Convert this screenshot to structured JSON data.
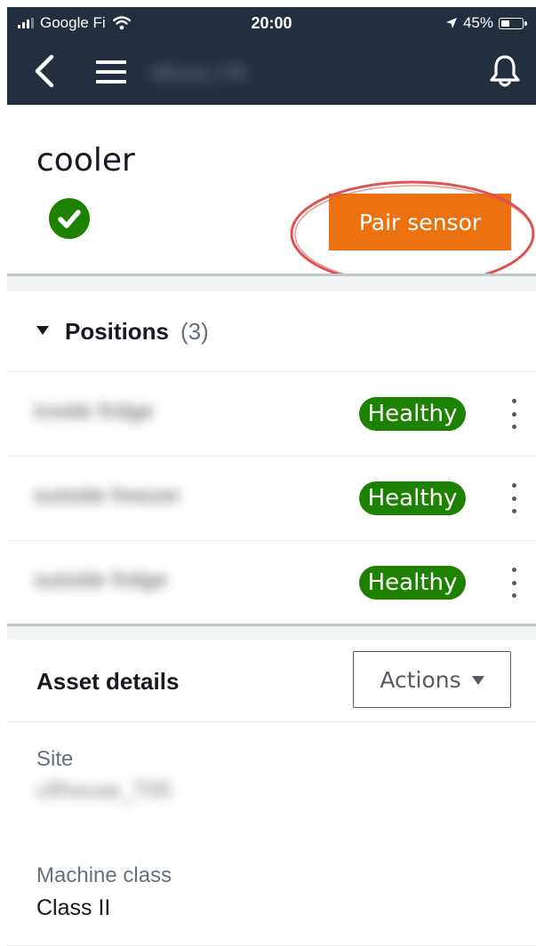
{
  "status_bar": {
    "carrier": "Google Fi",
    "time": "20:00",
    "battery": "45%",
    "battery_level": 0.45
  },
  "navbar": {
    "site_name": "ctfhouse_T05"
  },
  "asset": {
    "name": "cooler",
    "status": "ok",
    "pair_button_label": "Pair sensor"
  },
  "positions": {
    "title": "Positions",
    "count": "(3)",
    "items": [
      {
        "name": "inside fridge",
        "badge": "Healthy"
      },
      {
        "name": "outside freezer",
        "badge": "Healthy"
      },
      {
        "name": "outside fridge",
        "badge": "Healthy"
      }
    ]
  },
  "details": {
    "title": "Asset details",
    "actions_label": "Actions",
    "site_label": "Site",
    "site_value": "ctfhouse_T05",
    "machine_class_label": "Machine class",
    "machine_class_value": "Class II"
  },
  "colors": {
    "header_bg": "#232f3e",
    "primary_orange": "#ec7211",
    "healthy_green": "#1d8102",
    "highlight_ring": "#e0524f"
  }
}
